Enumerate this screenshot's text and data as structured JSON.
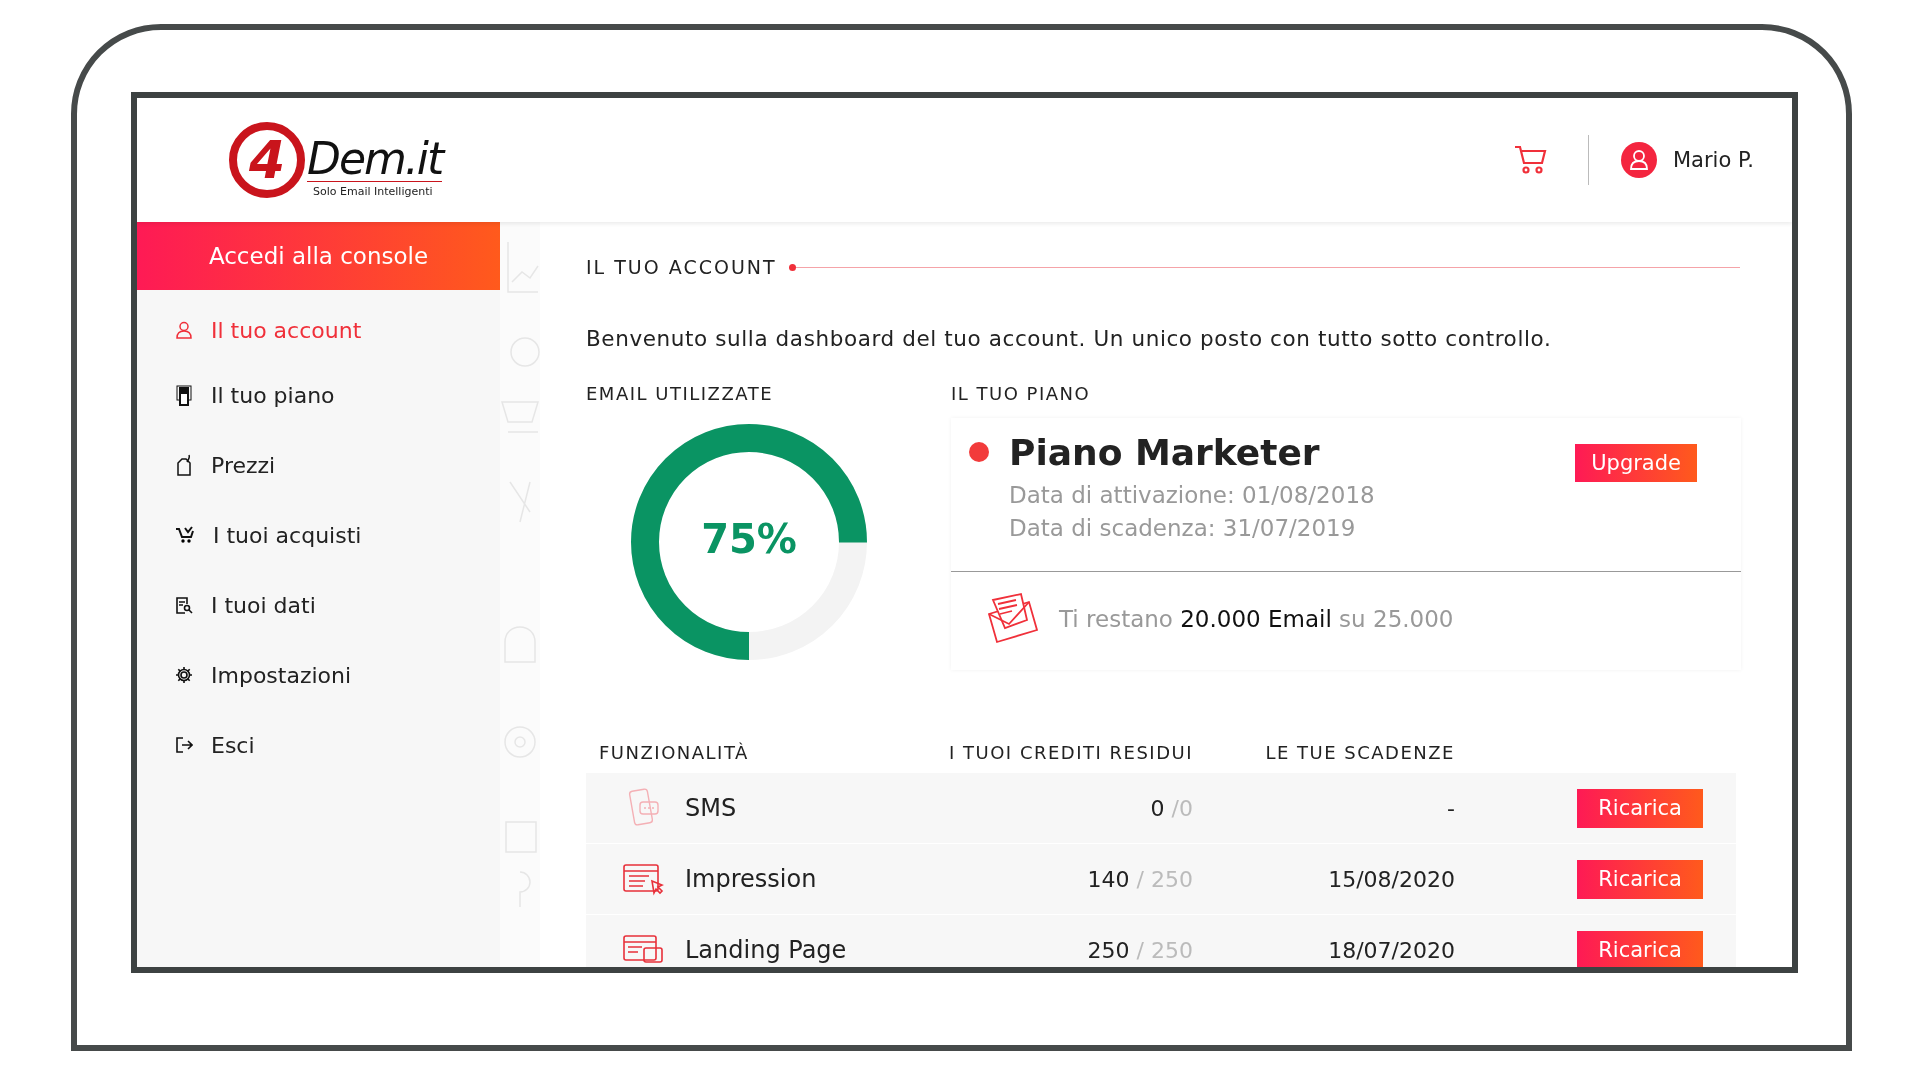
{
  "header": {
    "logo": {
      "mark": "4",
      "name": "Dem.it",
      "tagline": "Solo Email Intelligenti"
    },
    "user_name": "Mario P."
  },
  "sidebar": {
    "console_button": "Accedi alla console",
    "items": [
      {
        "label": "Il tuo account",
        "selected": true
      },
      {
        "label": "Il tuo piano",
        "selected": false
      },
      {
        "label": "Prezzi",
        "selected": false
      },
      {
        "label": "I tuoi acquisti",
        "selected": false
      },
      {
        "label": "I tuoi dati",
        "selected": false
      },
      {
        "label": "Impostazioni",
        "selected": false
      },
      {
        "label": "Esci",
        "selected": false
      }
    ]
  },
  "account": {
    "title": "IL TUO ACCOUNT",
    "welcome": "Benvenuto sulla dashboard del tuo account. Un unico posto con tutto sotto controllo.",
    "usage": {
      "label": "EMAIL UTILIZZATE",
      "level": 0.75,
      "reading": "75%"
    },
    "plan": {
      "label": "IL TUO PIANO",
      "name": "Piano Marketer",
      "activation": "Data di attivazione: 01/08/2018",
      "expiry": "Data di scadenza: 31/07/2019",
      "button": "Upgrade",
      "remaining": "Ti restano **20.000 Email** su 25.000"
    }
  },
  "features": {
    "columns": [
      "FUNZIONALITÀ",
      "I TUOI CREDITI RESIDUI",
      "LE TUE SCADENZE"
    ],
    "rows": [
      {
        "name": "SMS",
        "credits": "**0** /0",
        "expiry": "-",
        "button": "Ricarica"
      },
      {
        "name": "Impression",
        "credits": "**140** / 250",
        "expiry": "15/08/2020",
        "button": "Ricarica"
      },
      {
        "name": "Landing Page",
        "credits": "**250** / 250",
        "expiry": "18/07/2020",
        "button": "Ricarica"
      }
    ]
  }
}
